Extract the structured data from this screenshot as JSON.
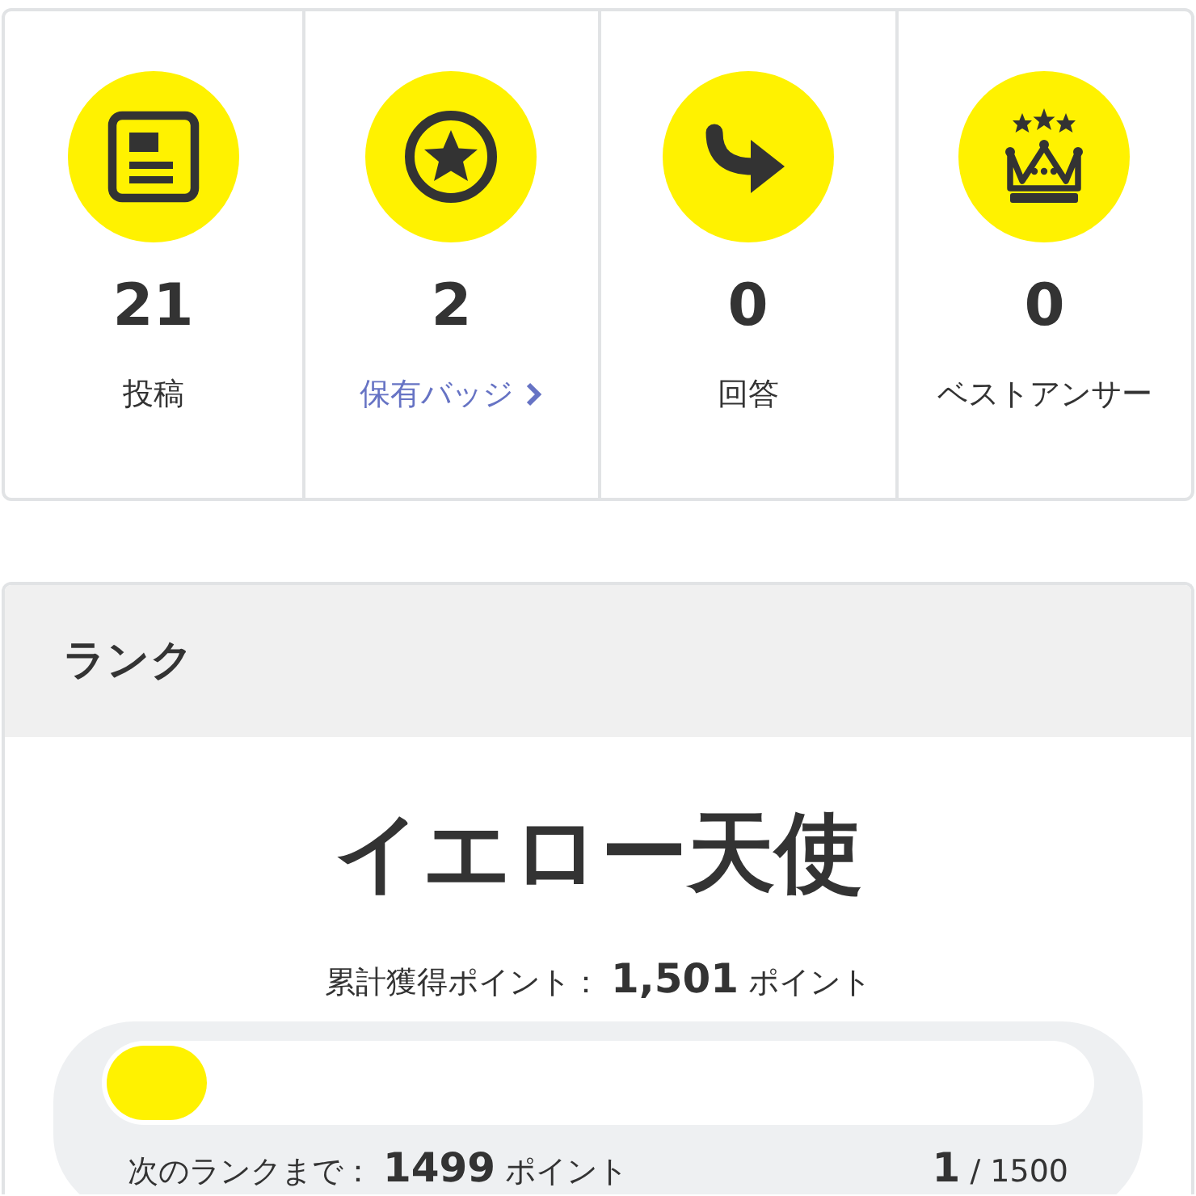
{
  "stats": [
    {
      "count": "21",
      "label": "投稿",
      "kind": "text"
    },
    {
      "count": "2",
      "label": "保有バッジ",
      "kind": "link"
    },
    {
      "count": "0",
      "label": "回答",
      "kind": "text"
    },
    {
      "count": "0",
      "label": "ベストアンサー",
      "kind": "text"
    }
  ],
  "rank": {
    "heading": "ランク",
    "name": "イエロー天使",
    "total": {
      "label": "累計獲得ポイント：",
      "value": "1,501",
      "unit": "ポイント"
    },
    "progress": {
      "level": 0.0007
    },
    "next": {
      "label": "次のランクまで：",
      "value": "1499",
      "unit": "ポイント",
      "current": "1",
      "total": "/ 1500"
    }
  }
}
